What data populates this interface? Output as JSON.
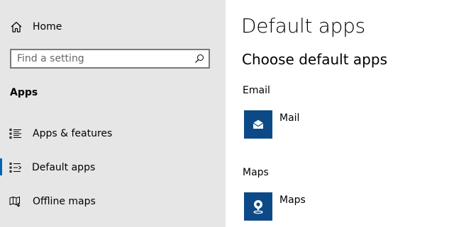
{
  "sidebar": {
    "home_label": "Home",
    "search_placeholder": "Find a setting",
    "section_label": "Apps",
    "items": [
      {
        "label": "Apps & features",
        "icon": "apps-features-icon"
      },
      {
        "label": "Default apps",
        "icon": "default-apps-icon",
        "selected": true
      },
      {
        "label": "Offline maps",
        "icon": "offline-maps-icon"
      }
    ]
  },
  "main": {
    "title": "Default apps",
    "subtitle": "Choose default apps",
    "categories": [
      {
        "label": "Email",
        "app": "Mail",
        "icon": "mail-icon"
      },
      {
        "label": "Maps",
        "app": "Maps",
        "icon": "maps-icon"
      }
    ]
  },
  "colors": {
    "sidebar_bg": "#e6e6e6",
    "accent": "#0063b1",
    "tile_bg": "#0b4a86"
  }
}
